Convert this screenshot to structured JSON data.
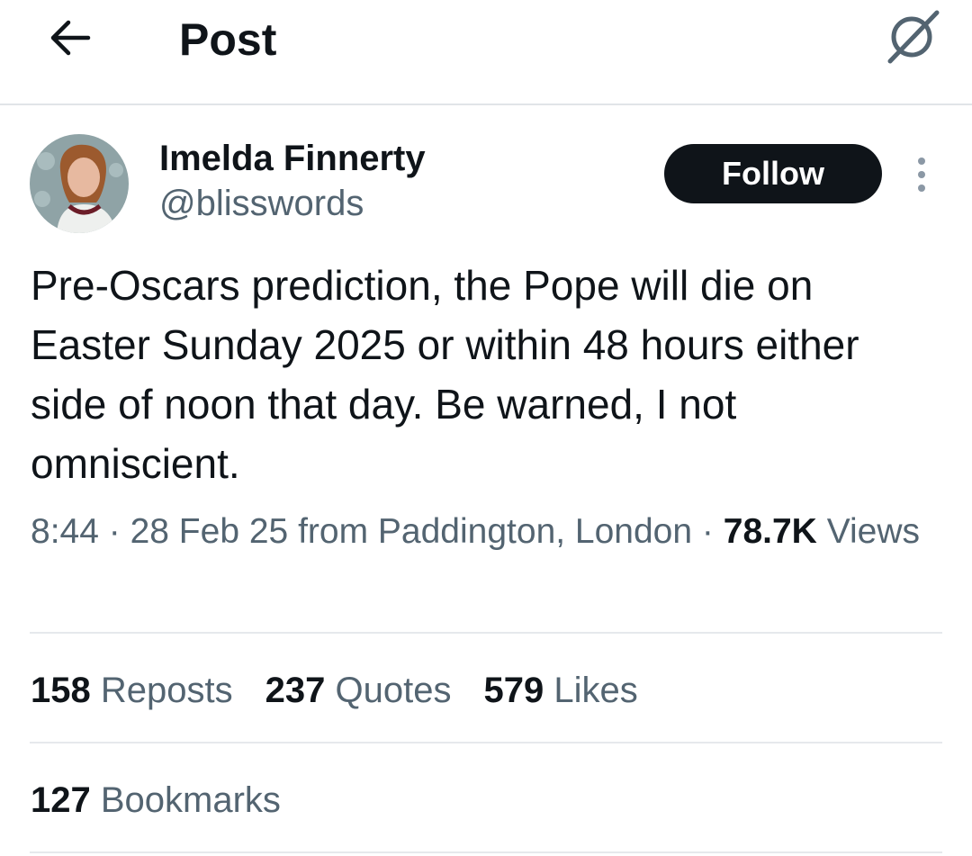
{
  "header": {
    "title": "Post"
  },
  "author": {
    "display_name": "Imelda Finnerty",
    "handle": "@blisswords",
    "follow_label": "Follow"
  },
  "post": {
    "text": "Pre-Oscars prediction, the Pope will die on Easter Sunday 2025 or within 48 hours either side of noon that day. Be warned, I not omniscient.",
    "time": "8:44",
    "date": "28 Feb 25",
    "location": "from Paddington, London",
    "views_count": "78.7K",
    "views_label": "Views",
    "separator": "·"
  },
  "stats": {
    "reposts_count": "158",
    "reposts_label": "Reposts",
    "quotes_count": "237",
    "quotes_label": "Quotes",
    "likes_count": "579",
    "likes_label": "Likes",
    "bookmarks_count": "127",
    "bookmarks_label": "Bookmarks"
  },
  "icons": {
    "back": "arrow-left-icon",
    "grok": "grok-icon",
    "more": "more-vertical-icon"
  },
  "colors": {
    "text_primary": "#0f1419",
    "text_secondary": "#536471",
    "divider": "#e6e9ec",
    "follow_bg": "#0f1419",
    "follow_text": "#ffffff"
  }
}
